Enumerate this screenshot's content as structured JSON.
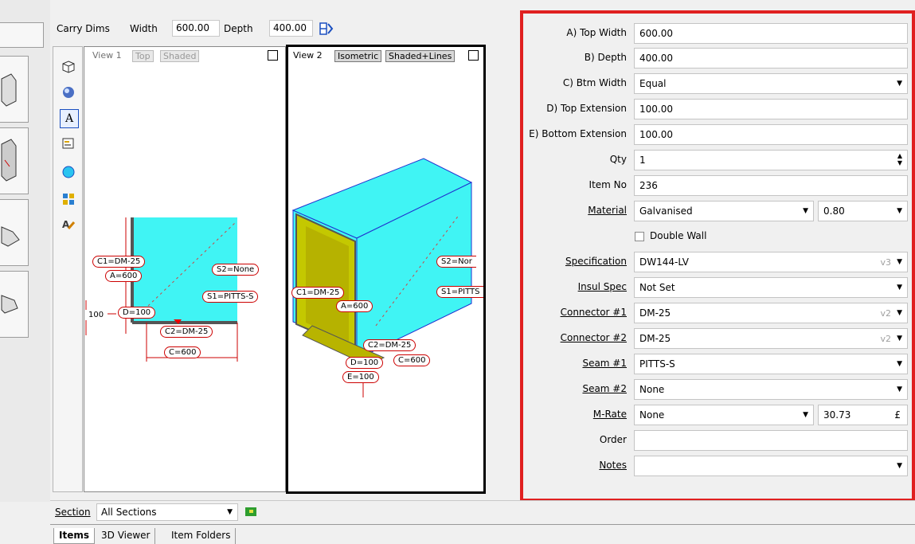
{
  "toolbar": {
    "carry_dims": "Carry Dims",
    "width_label": "Width",
    "width_value": "600.00",
    "depth_label": "Depth",
    "depth_value": "400.00"
  },
  "view1": {
    "title": "View 1",
    "mode": "Top",
    "render": "Shaded",
    "labels": {
      "c1": "C1=DM-25",
      "a": "A=600",
      "s2": "S2=None",
      "s1": "S1=PITTS-S",
      "d": "D=100",
      "c2": "C2=DM-25",
      "c": "C=600",
      "left": "100"
    }
  },
  "view2": {
    "title": "View 2",
    "mode": "Isometric",
    "render": "Shaded+Lines",
    "labels": {
      "c1": "C1=DM-25",
      "a": "A=600",
      "s2": "S2=Nor",
      "s1": "S1=PITTS",
      "c2": "C2=DM-25",
      "d": "D=100",
      "c": "C=600",
      "e": "E=100"
    }
  },
  "form": {
    "top_width_label": "A) Top Width",
    "top_width": "600.00",
    "depth_label": "B) Depth",
    "depth": "400.00",
    "btm_width_label": "C) Btm Width",
    "btm_width": "Equal",
    "top_ext_label": "D) Top Extension",
    "top_ext": "100.00",
    "bottom_ext_label": "E) Bottom Extension",
    "bottom_ext": "100.00",
    "qty_label": "Qty",
    "qty": "1",
    "item_no_label": "Item No",
    "item_no": "236",
    "material_label": "Material",
    "material": "Galvanised",
    "gauge": "0.80",
    "double_wall_label": "Double Wall",
    "spec_label": "Specification",
    "spec": "DW144-LV",
    "spec_ver": "v3",
    "insul_label": "Insul Spec",
    "insul": "Not Set",
    "conn1_label": "Connector #1",
    "conn1": "DM-25",
    "conn1_ver": "v2",
    "conn2_label": "Connector #2",
    "conn2": "DM-25",
    "conn2_ver": "v2",
    "seam1_label": "Seam #1",
    "seam1": "PITTS-S",
    "seam2_label": "Seam #2",
    "seam2": "None",
    "mrate_label": "M-Rate",
    "mrate": "None",
    "mrate_value": "30.73",
    "currency": "£",
    "order_label": "Order",
    "order": "",
    "notes_label": "Notes",
    "notes": ""
  },
  "bottom": {
    "section_label": "Section",
    "section_value": "All Sections",
    "tabs": [
      "Items",
      "3D Viewer",
      "Item Folders"
    ]
  }
}
